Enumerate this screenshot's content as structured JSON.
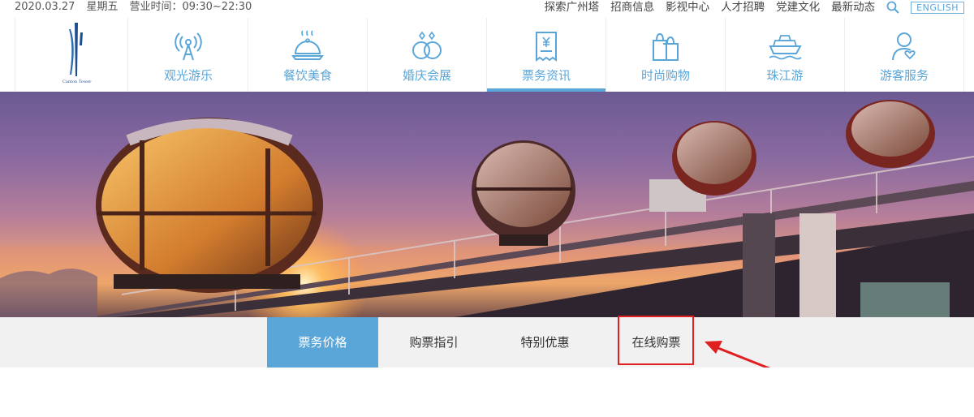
{
  "topbar": {
    "date": "2020.03.27",
    "weekday": "星期五",
    "hours": "营业时间：09:30~22:30",
    "links": [
      "探索广州塔",
      "招商信息",
      "影视中心",
      "人才招聘",
      "党建文化",
      "最新动态"
    ],
    "lang": "ENGLISH"
  },
  "logo": {
    "text": "Canton Tower"
  },
  "nav": {
    "items": [
      {
        "label": "观光游乐",
        "icon": "tower-signal-icon"
      },
      {
        "label": "餐饮美食",
        "icon": "dining-cloche-icon"
      },
      {
        "label": "婚庆会展",
        "icon": "wedding-rings-icon"
      },
      {
        "label": "票务资讯",
        "icon": "ticket-icon"
      },
      {
        "label": "时尚购物",
        "icon": "shopping-bag-icon"
      },
      {
        "label": "珠江游",
        "icon": "cruise-ship-icon"
      },
      {
        "label": "游客服务",
        "icon": "visitor-service-icon"
      }
    ],
    "active_index": 3
  },
  "subtabs": {
    "items": [
      "票务价格",
      "购票指引",
      "特别优惠",
      "在线购票"
    ],
    "active_index": 0
  },
  "colors": {
    "accent": "#5aa6d8",
    "highlight": "#e02020"
  }
}
